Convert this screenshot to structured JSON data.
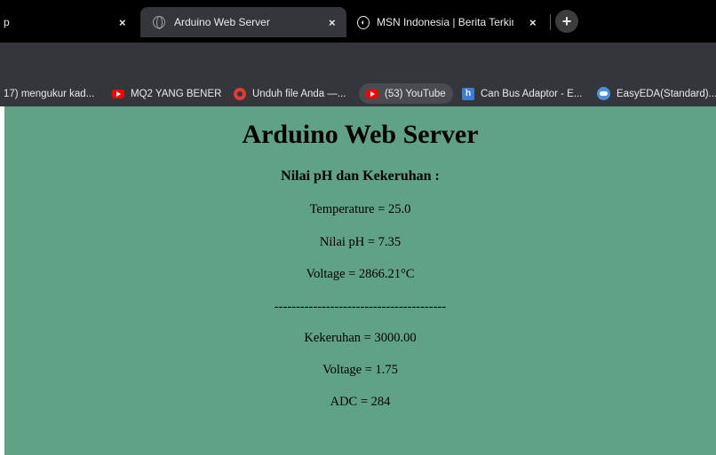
{
  "tabs": [
    {
      "label": "p",
      "close": "×"
    },
    {
      "label": "Arduino Web Server",
      "close": "×"
    },
    {
      "label": "MSN Indonesia | Berita Terkini I",
      "close": "×"
    }
  ],
  "new_tab": "+",
  "bookmarks": [
    {
      "label": "17) mengukur kad...",
      "icon": "none"
    },
    {
      "label": "MQ2 YANG BENER",
      "icon": "youtube-icon"
    },
    {
      "label": "Unduh file Anda —...",
      "icon": "unduh-icon"
    },
    {
      "label": "(53) YouTube",
      "icon": "youtube-icon"
    },
    {
      "label": "Can Bus Adaptor - E...",
      "icon": "h-icon"
    },
    {
      "label": "EasyEDA(Standard)...",
      "icon": "easyeda-icon"
    }
  ],
  "page": {
    "background": "#5fa285",
    "title": "Arduino Web Server",
    "subtitle": "Nilai pH dan Kekeruhan :",
    "lines": [
      "Temperature = 25.0",
      "Nilai pH = 7.35",
      "Voltage = 2866.21°C",
      "----------------------------------------",
      "Kekeruhan = 3000.00",
      "Voltage = 1.75",
      "ADC = 284"
    ]
  }
}
